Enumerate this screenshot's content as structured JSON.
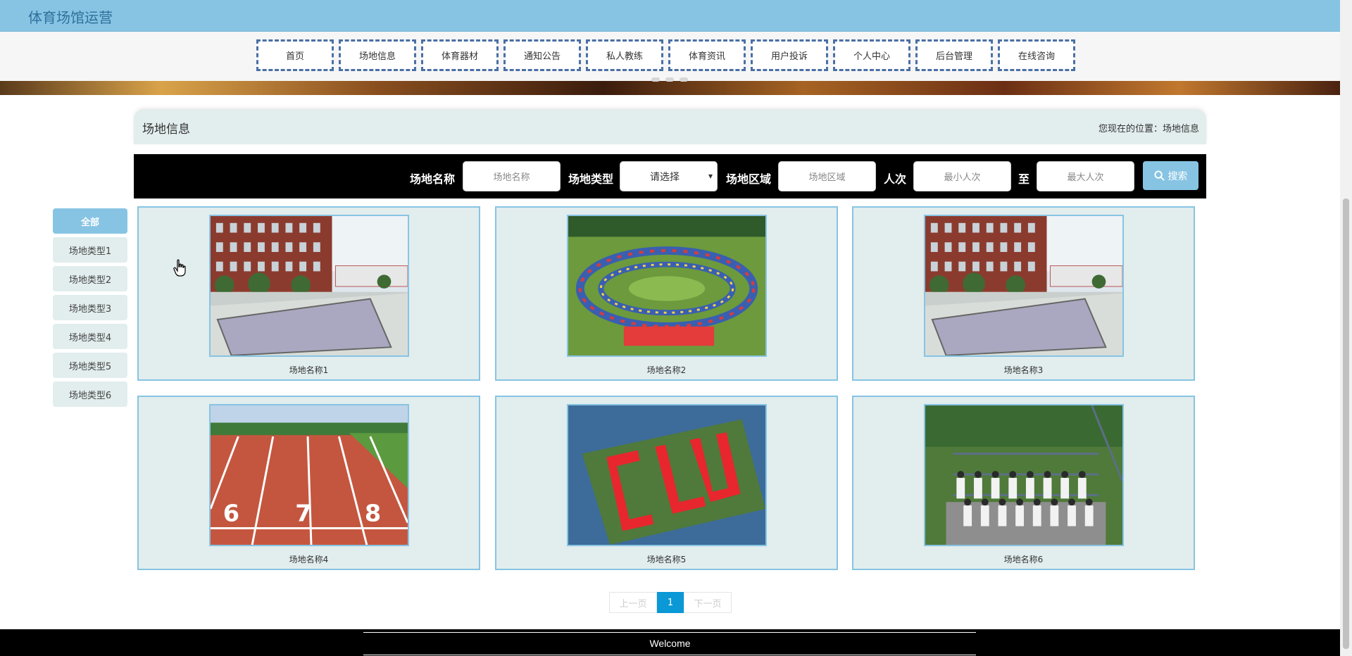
{
  "app": {
    "title": "体育场馆运营"
  },
  "nav": {
    "items": [
      {
        "label": "首页"
      },
      {
        "label": "场地信息"
      },
      {
        "label": "体育器材"
      },
      {
        "label": "通知公告"
      },
      {
        "label": "私人教练"
      },
      {
        "label": "体育资讯"
      },
      {
        "label": "用户投诉"
      },
      {
        "label": "个人中心"
      },
      {
        "label": "后台管理"
      },
      {
        "label": "在线咨询"
      }
    ]
  },
  "page": {
    "title": "场地信息",
    "breadcrumb": "您现在的位置：场地信息"
  },
  "search": {
    "name_label": "场地名称",
    "name_placeholder": "场地名称",
    "type_label": "场地类型",
    "type_selected": "请选择",
    "area_label": "场地区域",
    "area_placeholder": "场地区域",
    "count_label": "人次",
    "min_placeholder": "最小人次",
    "to_label": "至",
    "max_placeholder": "最大人次",
    "button_label": "搜索"
  },
  "categories": [
    {
      "label": "全部",
      "active": true
    },
    {
      "label": "场地类型1"
    },
    {
      "label": "场地类型2"
    },
    {
      "label": "场地类型3"
    },
    {
      "label": "场地类型4"
    },
    {
      "label": "场地类型5"
    },
    {
      "label": "场地类型6"
    }
  ],
  "cards": [
    {
      "name": "场地名称1",
      "image": "building-court-photo"
    },
    {
      "name": "场地名称2",
      "image": "circle-gathering-photo"
    },
    {
      "name": "场地名称3",
      "image": "building-court-photo"
    },
    {
      "name": "场地名称4",
      "image": "running-track-photo"
    },
    {
      "name": "场地名称5",
      "image": "red-letters-field-photo"
    },
    {
      "name": "场地名称6",
      "image": "group-photo"
    }
  ],
  "pagination": {
    "prev": "上一页",
    "current": "1",
    "next": "下一页"
  },
  "footer": {
    "text": "Welcome"
  },
  "colors": {
    "accent": "#87c4e3",
    "panel": "#e2eded",
    "page_active": "#0a98d6"
  }
}
